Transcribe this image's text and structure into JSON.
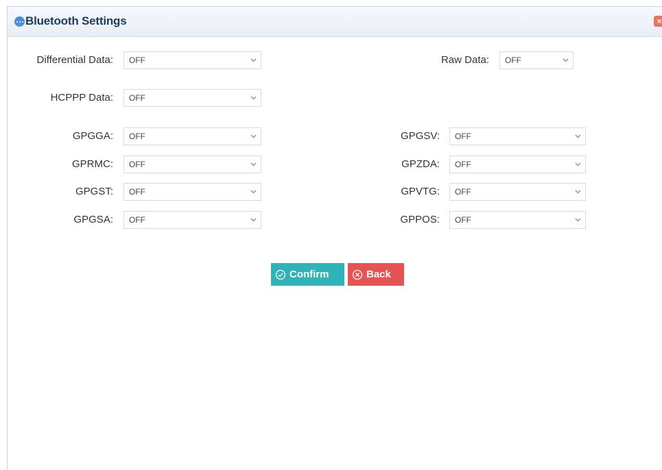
{
  "window": {
    "title": "Bluetooth Settings"
  },
  "fields": {
    "differential_data": {
      "label": "Differential Data:",
      "value": "OFF"
    },
    "raw_data": {
      "label": "Raw Data:",
      "value": "OFF"
    },
    "hcppp_data": {
      "label": "HCPPP Data:",
      "value": "OFF"
    },
    "gpgga": {
      "label": "GPGGA:",
      "value": "OFF"
    },
    "gpgsv": {
      "label": "GPGSV:",
      "value": "OFF"
    },
    "gprmc": {
      "label": "GPRMC:",
      "value": "OFF"
    },
    "gpzda": {
      "label": "GPZDA:",
      "value": "OFF"
    },
    "gpgst": {
      "label": "GPGST:",
      "value": "OFF"
    },
    "gpvtg": {
      "label": "GPVTG:",
      "value": "OFF"
    },
    "gpgsa": {
      "label": "GPGSA:",
      "value": "OFF"
    },
    "gppos": {
      "label": "GPPOS:",
      "value": "OFF"
    }
  },
  "buttons": {
    "confirm": "Confirm",
    "back": "Back"
  },
  "colors": {
    "confirm": "#2fb3b8",
    "back": "#e55353",
    "title": "#1f3a5f"
  }
}
